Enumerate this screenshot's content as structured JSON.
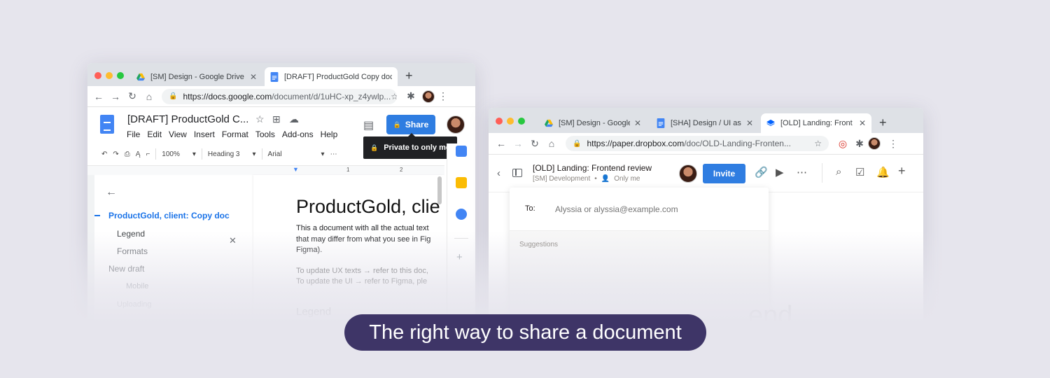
{
  "left_window": {
    "tabs": [
      {
        "label": "[SM] Design - Google Drive",
        "favicon": "google-drive-icon"
      },
      {
        "label": "[DRAFT] ProductGold Copy doc",
        "favicon": "google-docs-icon",
        "active": true
      }
    ],
    "url": {
      "host": "https://docs.google.com",
      "path": "/document/d/1uHC-xp_z4ywlp..."
    },
    "doc": {
      "title": "[DRAFT] ProductGold C...",
      "menu": [
        "File",
        "Edit",
        "View",
        "Insert",
        "Format",
        "Tools",
        "Add-ons",
        "Help"
      ],
      "share_label": "Share",
      "tooltip": "Private to only me",
      "toolbar": {
        "zoom": "100%",
        "style": "Heading 3",
        "font": "Arial"
      },
      "ruler": {
        "mark1": "1",
        "mark2": "2"
      },
      "outline": [
        {
          "label": "ProductGold, client: Copy doc",
          "active": true
        },
        {
          "label": "Legend"
        },
        {
          "label": "Formats"
        },
        {
          "label": "New draft"
        },
        {
          "label": "Mobile"
        },
        {
          "label": "Uploading"
        }
      ],
      "heading": "ProductGold, clie",
      "para1_line1": "This a document with all the actual text",
      "para1_line2": "that may differ from what you see in Fig",
      "para1_line3": "Figma).",
      "para2_line1": "To update UX texts → refer to this doc,",
      "para2_line2": "To update the UI → refer to Figma, ple",
      "legend_heading": "Legend",
      "legend_hint": "In editing → c"
    }
  },
  "right_window": {
    "tabs": [
      {
        "label": "[SM] Design - Google",
        "favicon": "google-drive-icon"
      },
      {
        "label": "[SHA] Design / UI as",
        "favicon": "google-docs-icon"
      },
      {
        "label": "[OLD] Landing: Front",
        "favicon": "dropbox-icon",
        "active": true
      }
    ],
    "url": {
      "host": "https://paper.dropbox.com",
      "path": "/doc/OLD-Landing-Fronten..."
    },
    "doc": {
      "title": "[OLD] Landing: Frontend review",
      "folder": "[SM] Development",
      "visibility": "Only me",
      "invite_label": "Invite",
      "to_label": "To:",
      "to_placeholder": "Alyssia or alyssia@example.com",
      "suggestions_label": "Suggestions",
      "ghost_text": "end"
    }
  },
  "caption": "The right way to share a document",
  "colors": {
    "accent": "#2f7de1",
    "caption_bg": "#3e3567",
    "background": "#e6e5ed"
  }
}
